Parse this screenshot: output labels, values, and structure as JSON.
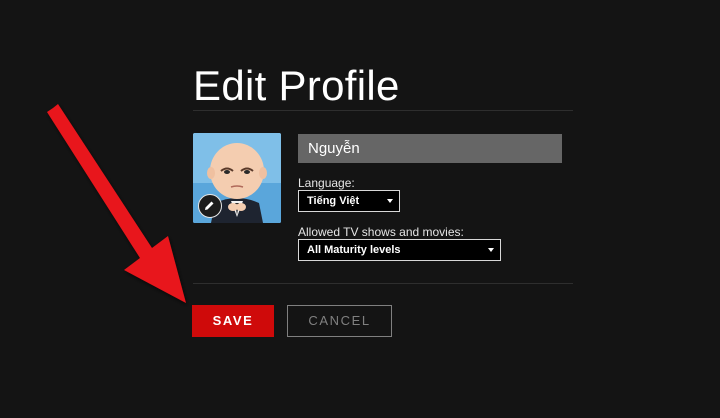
{
  "page": {
    "title": "Edit Profile"
  },
  "profile": {
    "name_value": "Nguyễn",
    "avatar_icon": "boss-baby-avatar",
    "edit_icon": "pencil-icon"
  },
  "language": {
    "label": "Language:",
    "selected": "Tiếng Việt"
  },
  "maturity": {
    "label": "Allowed TV shows and movies:",
    "selected": "All Maturity levels"
  },
  "actions": {
    "save_label": "SAVE",
    "cancel_label": "CANCEL"
  },
  "colors": {
    "background": "#141414",
    "save": "#cf0a0a",
    "annotation_arrow": "#e8141a"
  }
}
